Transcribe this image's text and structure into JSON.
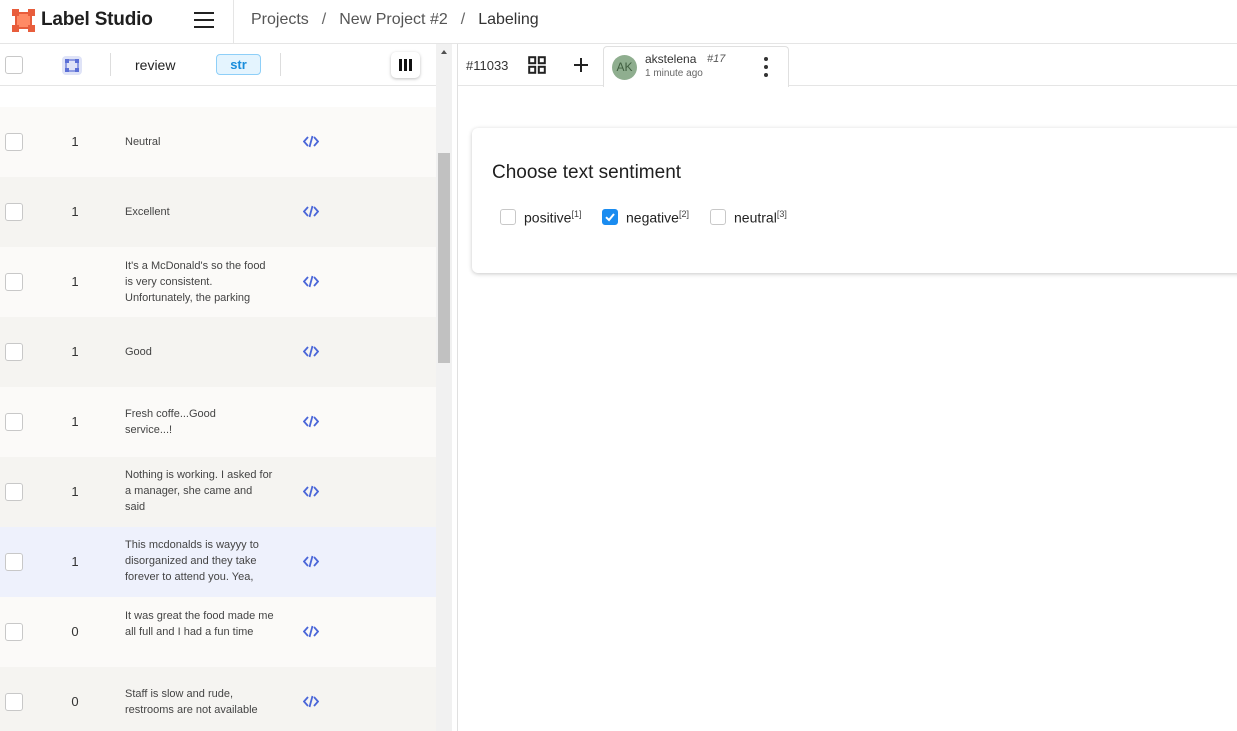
{
  "app": {
    "title": "Label Studio"
  },
  "breadcrumb": {
    "items": [
      "Projects",
      "New Project #2"
    ],
    "separator": "/",
    "current": "Labeling"
  },
  "table": {
    "columns": {
      "review": "review",
      "type_badge": "str"
    },
    "rows": [
      {
        "value": "1",
        "review": "Neutral"
      },
      {
        "value": "1",
        "review": "Excellent"
      },
      {
        "value": "1",
        "review": "It's a McDonald's so the food is very consistent. Unfortunately, the parking"
      },
      {
        "value": "1",
        "review": "Good"
      },
      {
        "value": "1",
        "review": "Fresh coffe...Good service...!"
      },
      {
        "value": "1",
        "review": "Nothing is working. I asked for a manager, she came and said"
      },
      {
        "value": "1",
        "review": "This mcdonalds is wayyy to disorganized and they take forever to attend you. Yea,"
      },
      {
        "value": "0",
        "review": "It was great the food made me all full and I had a fun time"
      },
      {
        "value": "0",
        "review": "Staff is slow and rude, restrooms are not available"
      }
    ]
  },
  "task": {
    "id": "#11033"
  },
  "annotation": {
    "avatar": "AK",
    "user": "akstelena",
    "number": "#17",
    "time": "1 minute ago"
  },
  "labeling": {
    "title": "Choose text sentiment",
    "choices": [
      {
        "label": "positive",
        "hotkey": "[1]",
        "checked": false
      },
      {
        "label": "negative",
        "hotkey": "[2]",
        "checked": true
      },
      {
        "label": "neutral",
        "hotkey": "[3]",
        "checked": false
      }
    ]
  },
  "colors": {
    "accent": "#1a8cf0",
    "logo": "#e85d3c",
    "badge": "#1a8ddb",
    "code_icon": "#4a66d8"
  }
}
